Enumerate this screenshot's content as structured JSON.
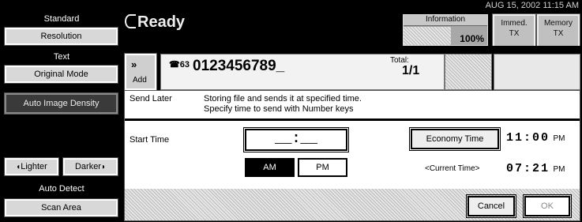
{
  "datebar": {
    "text": "AUG 15, 2002  11:15 AM"
  },
  "left_panel": {
    "standard_label": "Standard",
    "resolution_button": "Resolution",
    "text_label": "Text",
    "original_mode_button": "Original Mode",
    "auto_image_density_button": "Auto Image Density",
    "lighter_button": "Lighter",
    "darker_button": "Darker",
    "auto_detect_label": "Auto Detect",
    "scan_area_button": "Scan Area"
  },
  "status": {
    "ready_text": "Ready",
    "information_label": "Information",
    "memory_percent": "100%",
    "immed_tx_button": "Immed.\nTX",
    "memory_tx_button": "Memory\nTX"
  },
  "destination": {
    "add_label": "Add",
    "add_arrow": "»",
    "tel_icon": "☎63",
    "number": "0123456789_",
    "total_label": "Total:",
    "total_value": "1/1"
  },
  "dialog": {
    "title": "Send Later",
    "description_line1": "Storing file and sends it at specified time.",
    "description_line2": "Specify time to send with Number keys",
    "start_time_label": "Start Time",
    "time_input_value": "__:__",
    "am_button": "AM",
    "pm_button": "PM",
    "economy_time_button": "Economy Time",
    "economy_time_value": "11:00",
    "economy_time_suffix": "PM",
    "current_time_label": "<Current Time>",
    "current_time_value": "07:21",
    "current_time_suffix": "PM",
    "cancel_button": "Cancel",
    "ok_button": "OK"
  }
}
